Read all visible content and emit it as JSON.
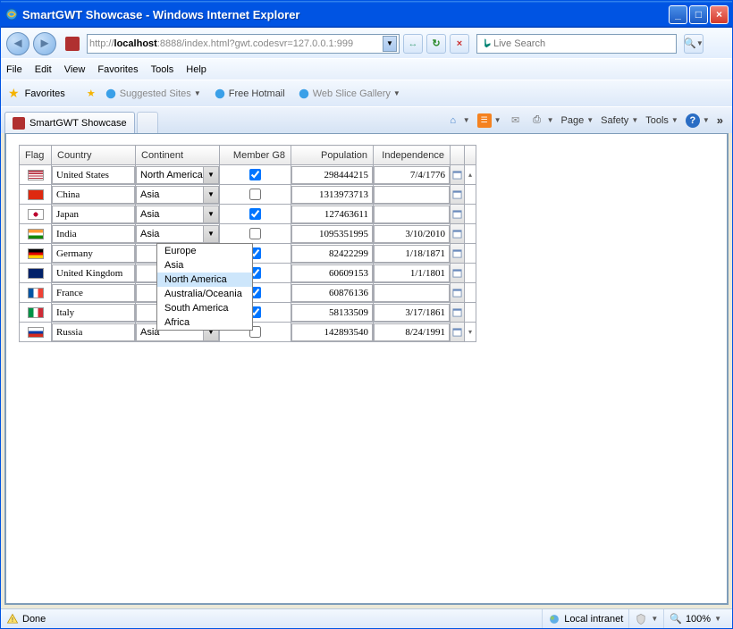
{
  "window": {
    "title": "SmartGWT Showcase - Windows Internet Explorer"
  },
  "nav": {
    "url_prefix": "http://",
    "url_host": "localhost",
    "url_rest": ":8888/index.html?gwt.codesvr=127.0.0.1:999",
    "search_placeholder": "Live Search"
  },
  "menu": {
    "file": "File",
    "edit": "Edit",
    "view": "View",
    "favorites": "Favorites",
    "tools": "Tools",
    "help": "Help"
  },
  "favbar": {
    "favorites": "Favorites",
    "suggested": "Suggested Sites",
    "hotmail": "Free Hotmail",
    "webslice": "Web Slice Gallery"
  },
  "tab": {
    "label": "SmartGWT Showcase"
  },
  "cmdbar": {
    "page": "Page",
    "safety": "Safety",
    "tools": "Tools"
  },
  "grid": {
    "headers": {
      "flag": "Flag",
      "country": "Country",
      "continent": "Continent",
      "g8": "Member G8",
      "population": "Population",
      "independence": "Independence"
    },
    "rows": [
      {
        "country": "United States",
        "continent": "North America",
        "g8": true,
        "population": "298444215",
        "independence": "7/4/1776",
        "flag": "linear-gradient(#b22234 0 8%,#fff 8% 16%,#b22234 16% 24%,#fff 24% 32%,#b22234 32% 40%,#fff 40% 48%,#b22234 48% 56%,#fff 56% 64%,#b22234 64% 72%,#fff 72% 80%,#b22234 80% 88%,#fff 88% 100%)"
      },
      {
        "country": "China",
        "continent": "Asia",
        "g8": false,
        "population": "1313973713",
        "independence": "",
        "flag": "#de2910"
      },
      {
        "country": "Japan",
        "continent": "Asia",
        "g8": true,
        "population": "127463611",
        "independence": "",
        "flag": "radial-gradient(circle,#bc002d 25%,#fff 27%)"
      },
      {
        "country": "India",
        "continent": "Asia",
        "g8": false,
        "population": "1095351995",
        "independence": "3/10/2010",
        "flag": "linear-gradient(#ff9933 0 33%,#fff 33% 66%,#138808 66% 100%)"
      },
      {
        "country": "Germany",
        "continent": "",
        "g8": true,
        "population": "82422299",
        "independence": "1/18/1871",
        "flag": "linear-gradient(#000 0 33%,#dd0000 33% 66%,#ffce00 66% 100%)"
      },
      {
        "country": "United Kingdom",
        "continent": "",
        "g8": true,
        "population": "60609153",
        "independence": "1/1/1801",
        "flag": "#012169"
      },
      {
        "country": "France",
        "continent": "",
        "g8": true,
        "population": "60876136",
        "independence": "",
        "flag": "linear-gradient(90deg,#0055a4 0 33%,#fff 33% 66%,#ef4135 66% 100%)"
      },
      {
        "country": "Italy",
        "continent": "",
        "g8": true,
        "population": "58133509",
        "independence": "3/17/1861",
        "flag": "linear-gradient(90deg,#009246 0 33%,#fff 33% 66%,#ce2b37 66% 100%)"
      },
      {
        "country": "Russia",
        "continent": "Asia",
        "g8": false,
        "population": "142893540",
        "independence": "8/24/1991",
        "flag": "linear-gradient(#fff 0 33%,#0039a6 33% 66%,#d52b1e 66% 100%)"
      }
    ],
    "continent_options": [
      "Europe",
      "Asia",
      "North America",
      "Australia/Oceania",
      "South America",
      "Africa"
    ],
    "highlighted_option": "North America"
  },
  "status": {
    "done": "Done",
    "zone": "Local intranet",
    "zoom": "100%"
  }
}
